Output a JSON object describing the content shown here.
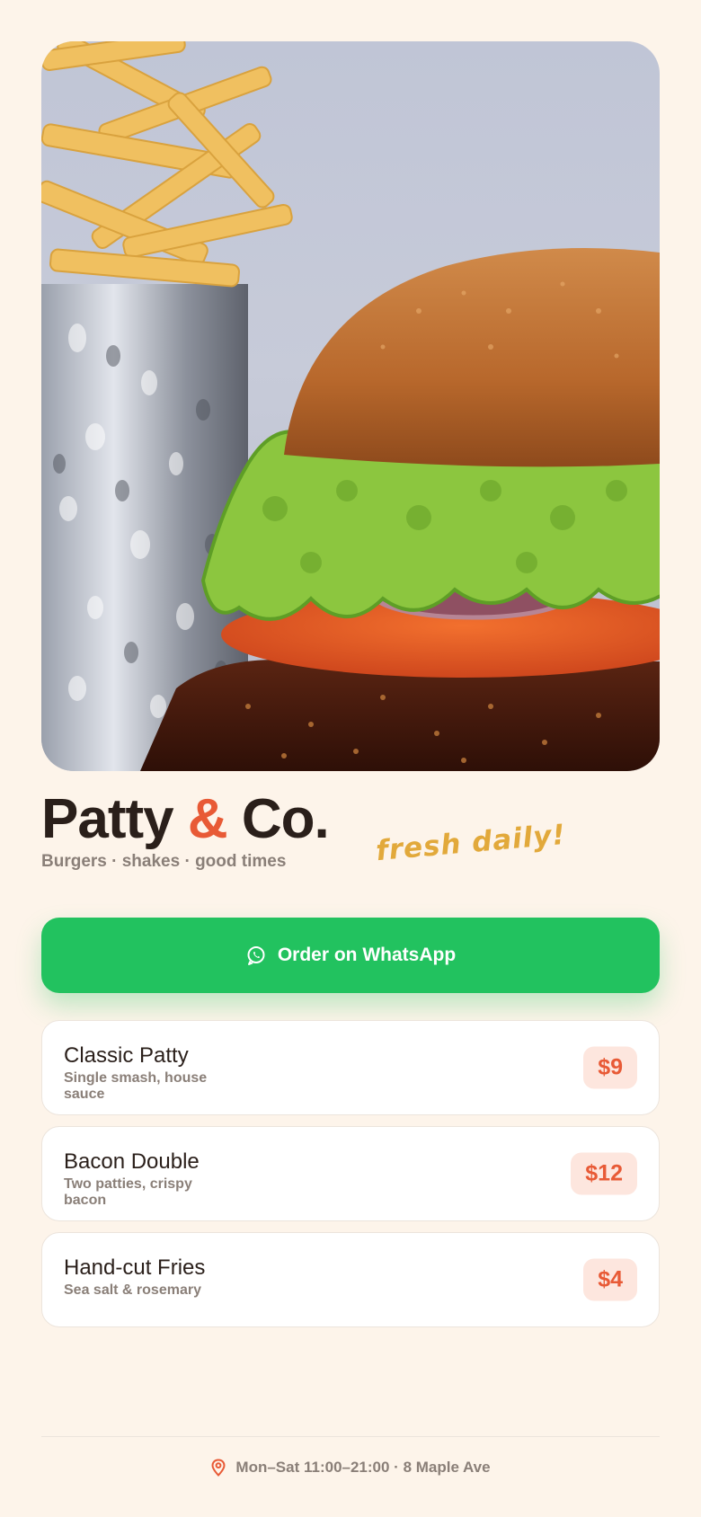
{
  "hero": {
    "image": "burger-and-fries-photo"
  },
  "brand": {
    "name_part1": "Patty ",
    "ampersand": "&",
    "name_part2": " Co.",
    "tagline": "Burgers · shakes · good times",
    "sticker": "fresh daily!"
  },
  "cta": {
    "label": "Order on WhatsApp",
    "icon": "whatsapp-icon",
    "color": "#22c25f"
  },
  "menu": {
    "items": [
      {
        "name": "Classic Patty",
        "desc": "Single smash, house sauce",
        "price": "$9"
      },
      {
        "name": "Bacon Double",
        "desc": "Two patties, crispy bacon",
        "price": "$12"
      },
      {
        "name": "Hand-cut Fries",
        "desc": "Sea salt & rosemary",
        "price": "$4"
      }
    ]
  },
  "footer": {
    "icon": "location-pin-icon",
    "text": "Mon–Sat 11:00–21:00 · 8 Maple Ave"
  },
  "colors": {
    "background": "#fdf4ea",
    "accent": "#e85a36",
    "text": "#2a1f1a",
    "muted": "#8a7f78",
    "sticker": "#e2a93b"
  }
}
